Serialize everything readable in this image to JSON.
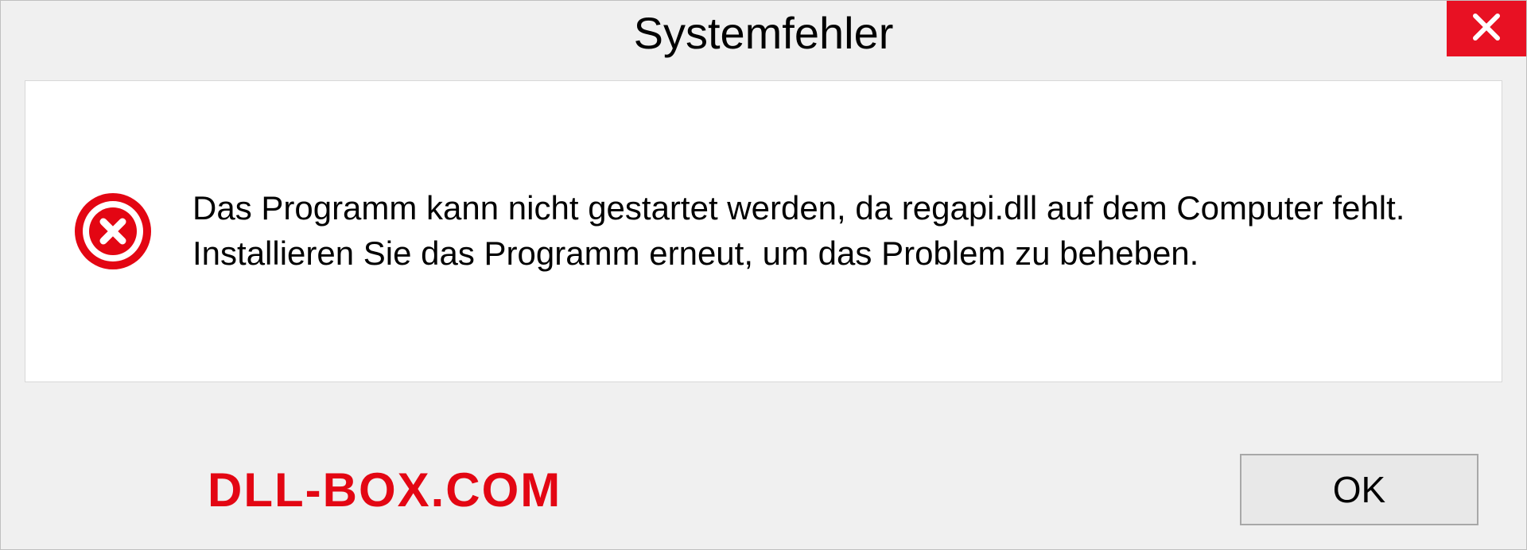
{
  "dialog": {
    "title": "Systemfehler",
    "message": "Das Programm kann nicht gestartet werden, da regapi.dll auf dem Computer fehlt. Installieren Sie das Programm erneut, um das Problem zu beheben.",
    "ok_label": "OK"
  },
  "watermark": "DLL-BOX.COM"
}
